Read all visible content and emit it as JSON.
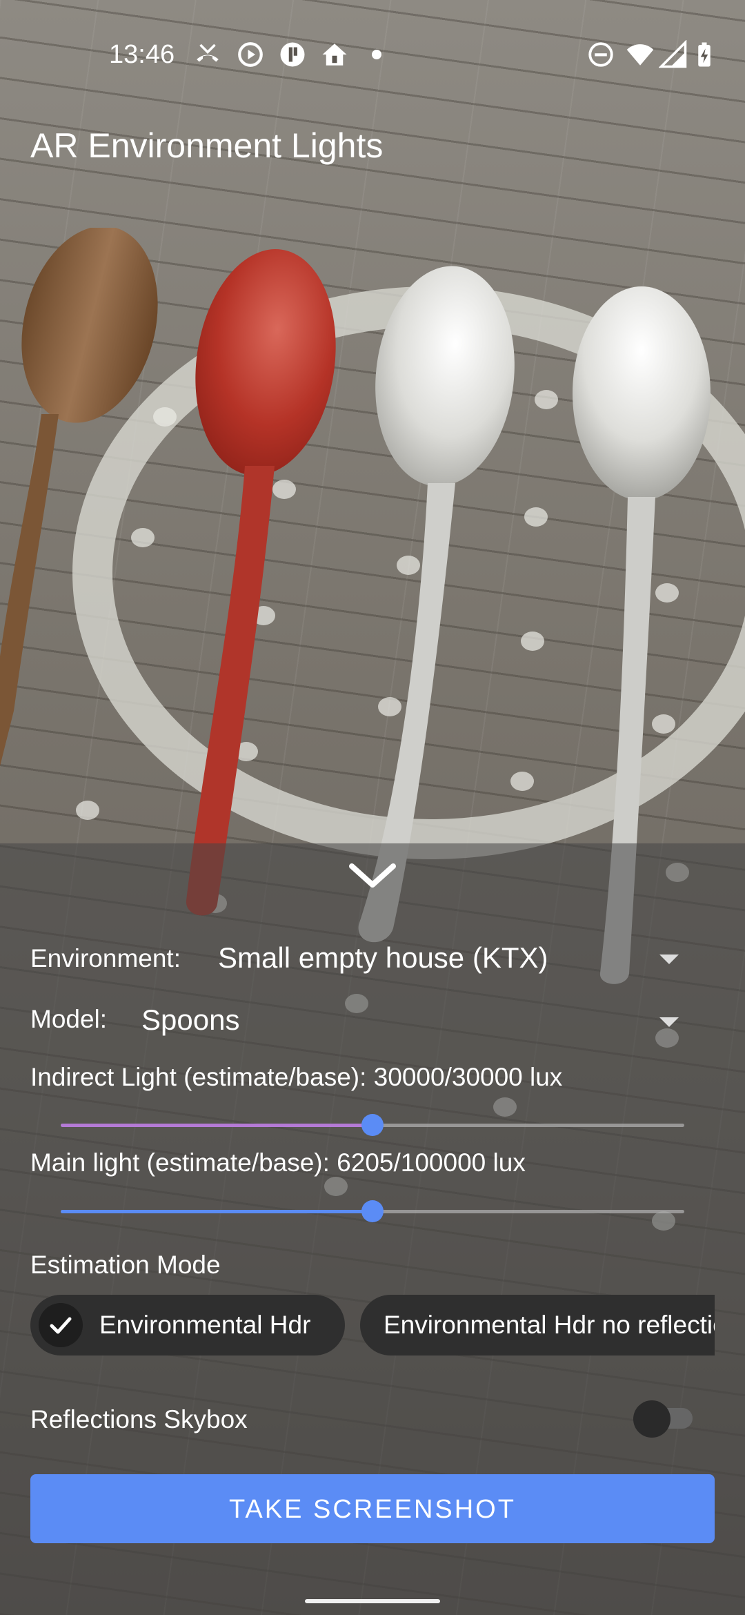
{
  "status_bar": {
    "time": "13:46",
    "left_icons": [
      "missed-call-icon",
      "play-circle-icon",
      "app-badge-icon",
      "home-alert-icon",
      "notification-dot-icon"
    ],
    "right_icons": [
      "do-not-disturb-icon",
      "wifi-icon",
      "signal-icon",
      "battery-charging-icon"
    ]
  },
  "app": {
    "title": "AR Environment Lights"
  },
  "controls": {
    "environment": {
      "label": "Environment:",
      "value": "Small empty house (KTX)"
    },
    "model": {
      "label": "Model:",
      "value": "Spoons"
    },
    "indirect_light": {
      "label": "Indirect Light (estimate/base): 30000/30000 lux",
      "slider_fraction": 0.5,
      "fill_color": "#b57ad6"
    },
    "main_light": {
      "label": "Main light (estimate/base): 6205/100000 lux",
      "slider_fraction": 0.5,
      "fill_color": "#5b8cf5"
    },
    "estimation_mode": {
      "label": "Estimation Mode",
      "chips": [
        {
          "label": "Environmental Hdr",
          "selected": true
        },
        {
          "label": "Environmental Hdr no reflections",
          "selected": false
        }
      ]
    },
    "reflections_skybox": {
      "label": "Reflections Skybox",
      "on": false
    },
    "take_screenshot": "TAKE SCREENSHOT"
  },
  "colors": {
    "accent": "#5b8cf5",
    "panel": "#464646"
  }
}
